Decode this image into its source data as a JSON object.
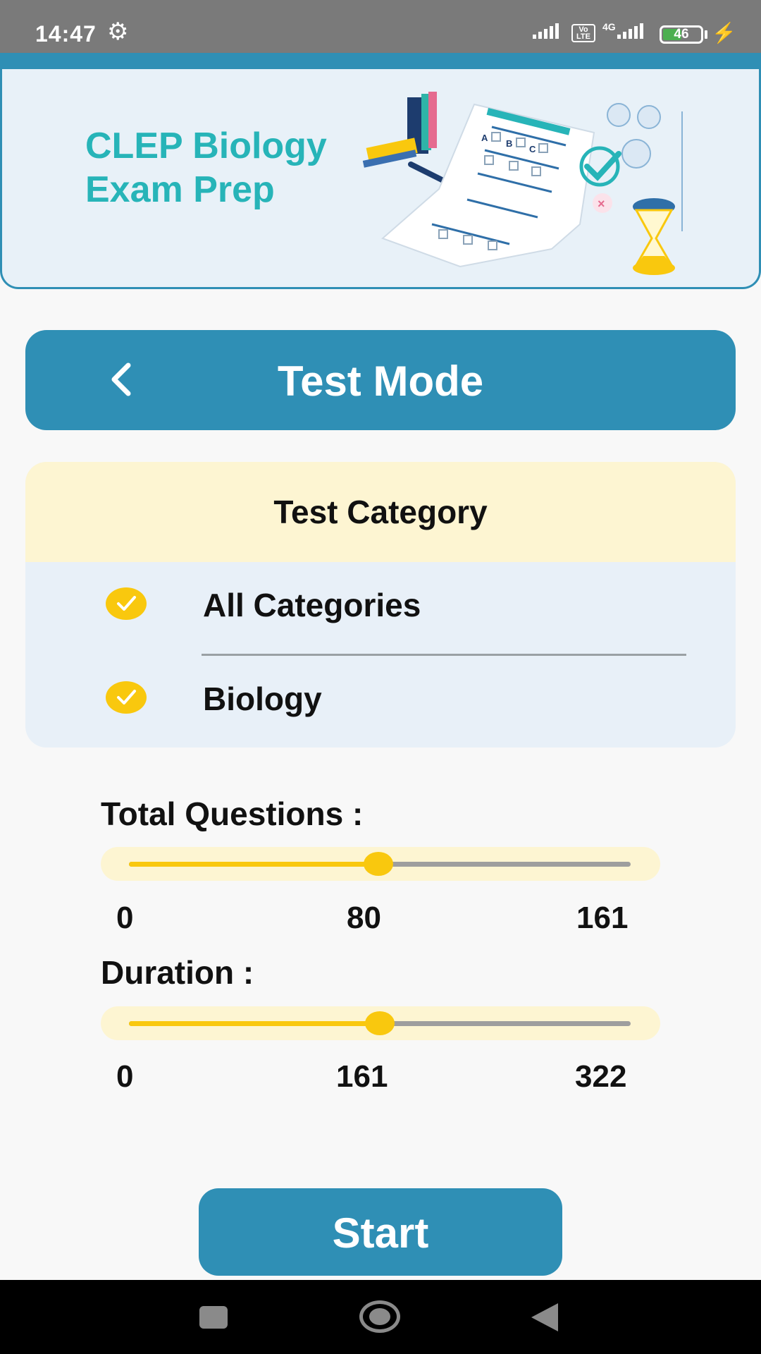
{
  "status_bar": {
    "time": "14:47",
    "volte": "Vo LTE",
    "network": "4G",
    "battery": "46"
  },
  "banner": {
    "title": "CLEP Biology Exam Prep",
    "illustration_labels": [
      "A",
      "B",
      "C"
    ]
  },
  "header": {
    "title": "Test Mode",
    "back_icon": "chevron-left-icon"
  },
  "category": {
    "title": "Test Category",
    "items": [
      {
        "label": "All Categories",
        "checked": true
      },
      {
        "label": "Biology",
        "checked": true
      }
    ]
  },
  "total_questions": {
    "label": "Total Questions :",
    "min": "0",
    "current": "80",
    "max": "161",
    "value": 80,
    "range": [
      0,
      161
    ]
  },
  "duration": {
    "label": "Duration :",
    "min": "0",
    "current": "161",
    "max": "322",
    "value": 161,
    "range": [
      0,
      322
    ]
  },
  "actions": {
    "start_label": "Start"
  },
  "colors": {
    "primary": "#2f8fb5",
    "accent": "#f9c80e",
    "title_teal": "#27b4b8",
    "cream": "#fdf5d2",
    "card": "#e8f0f8"
  }
}
